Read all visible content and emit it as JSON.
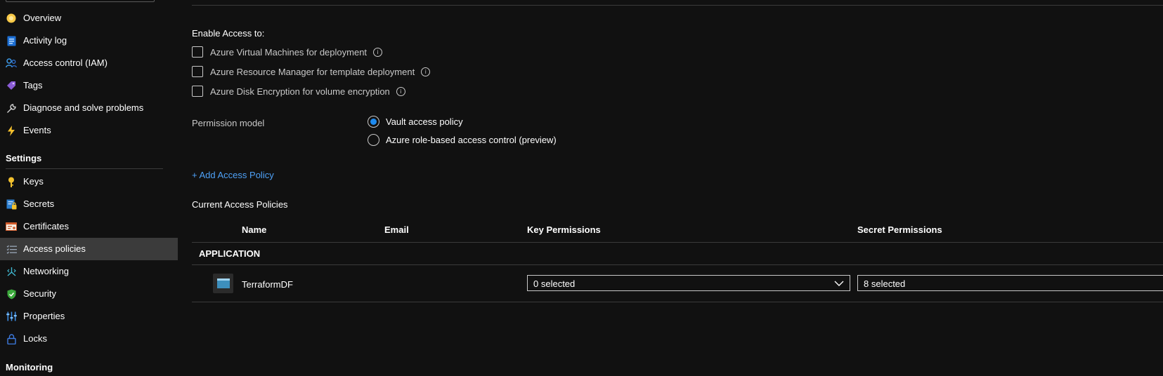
{
  "sidebar": {
    "items": [
      {
        "label": "Overview",
        "icon": "overview-icon"
      },
      {
        "label": "Activity log",
        "icon": "activity-log-icon"
      },
      {
        "label": "Access control (IAM)",
        "icon": "iam-icon"
      },
      {
        "label": "Tags",
        "icon": "tag-icon"
      },
      {
        "label": "Diagnose and solve problems",
        "icon": "wrench-icon"
      },
      {
        "label": "Events",
        "icon": "lightning-icon"
      }
    ],
    "settings_heading": "Settings",
    "settings_items": [
      {
        "label": "Keys",
        "icon": "key-icon"
      },
      {
        "label": "Secrets",
        "icon": "secret-icon"
      },
      {
        "label": "Certificates",
        "icon": "certificate-icon"
      },
      {
        "label": "Access policies",
        "icon": "access-policies-icon",
        "selected": true
      },
      {
        "label": "Networking",
        "icon": "networking-icon"
      },
      {
        "label": "Security",
        "icon": "shield-icon"
      },
      {
        "label": "Properties",
        "icon": "properties-icon"
      },
      {
        "label": "Locks",
        "icon": "lock-icon"
      }
    ],
    "monitoring_heading": "Monitoring"
  },
  "main": {
    "enable_access_label": "Enable Access to:",
    "enable_options": [
      {
        "label": "Azure Virtual Machines for deployment",
        "checked": false
      },
      {
        "label": "Azure Resource Manager for template deployment",
        "checked": false
      },
      {
        "label": "Azure Disk Encryption for volume encryption",
        "checked": false
      }
    ],
    "permission_model_label": "Permission model",
    "permission_options": [
      {
        "label": "Vault access policy",
        "selected": true
      },
      {
        "label": "Azure role-based access control (preview)",
        "selected": false
      }
    ],
    "add_policy_link": "+ Add Access Policy",
    "current_policies_label": "Current Access Policies",
    "table": {
      "columns": [
        "Name",
        "Email",
        "Key Permissions",
        "Secret Permissions"
      ],
      "group": "APPLICATION",
      "rows": [
        {
          "name": "TerraformDF",
          "email": "",
          "key_permissions": "0 selected",
          "secret_permissions": "8 selected"
        }
      ]
    }
  },
  "colors": {
    "background": "#111111",
    "selected_item": "#3b3b3b",
    "link": "#4ea1f7",
    "radio_accent": "#1e8bf0"
  }
}
